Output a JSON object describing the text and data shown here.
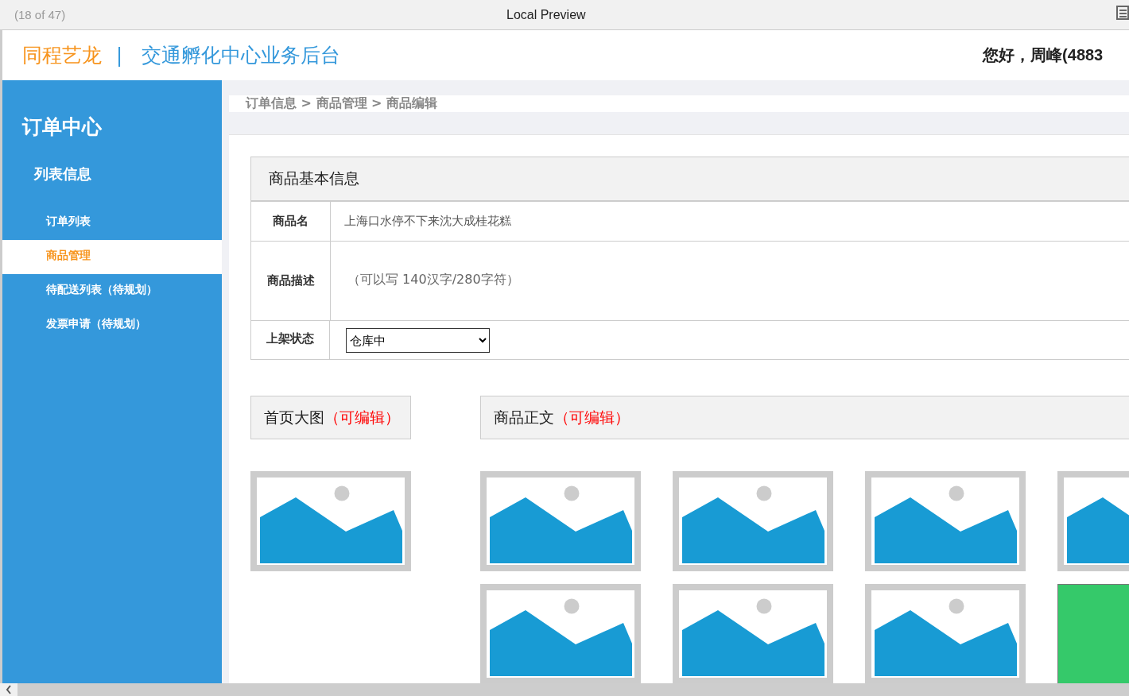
{
  "window": {
    "counter": "(18 of 47)",
    "title": "Local Preview"
  },
  "header": {
    "brand": "同程艺龙",
    "separator": "|",
    "system_name": "交通孵化中心业务后台",
    "greeting": "您好，周峰(4883"
  },
  "sidebar": {
    "title": "订单中心",
    "group": "列表信息",
    "items": [
      {
        "label": "订单列表",
        "selected": false
      },
      {
        "label": "商品管理",
        "selected": true
      },
      {
        "label": "待配送列表（待规划）",
        "selected": false
      },
      {
        "label": "发票申请（待规划）",
        "selected": false
      }
    ]
  },
  "breadcrumb": "订单信息 > 商品管理 > 商品编辑",
  "basic_info": {
    "title": "商品基本信息",
    "fields": [
      {
        "kind": "text",
        "label": "商品名",
        "value": "上海口水停不下来沈大成桂花糕"
      },
      {
        "kind": "textarea",
        "label": "商品描述",
        "placeholder": "（可以写 140汉字/280字符）"
      },
      {
        "kind": "select",
        "label": "上架状态",
        "value": "仓库中"
      }
    ]
  },
  "cover_section": {
    "title": "首页大图",
    "note": "（可编辑）",
    "images": [
      {
        "kind": "placeholder"
      }
    ]
  },
  "body_section": {
    "title": "商品正文",
    "note": "（可编辑）",
    "images": [
      {
        "kind": "placeholder"
      },
      {
        "kind": "placeholder"
      },
      {
        "kind": "placeholder"
      },
      {
        "kind": "placeholder"
      },
      {
        "kind": "placeholder"
      },
      {
        "kind": "placeholder"
      },
      {
        "kind": "placeholder"
      },
      {
        "kind": "tile",
        "color": "#35c96a"
      }
    ]
  }
}
